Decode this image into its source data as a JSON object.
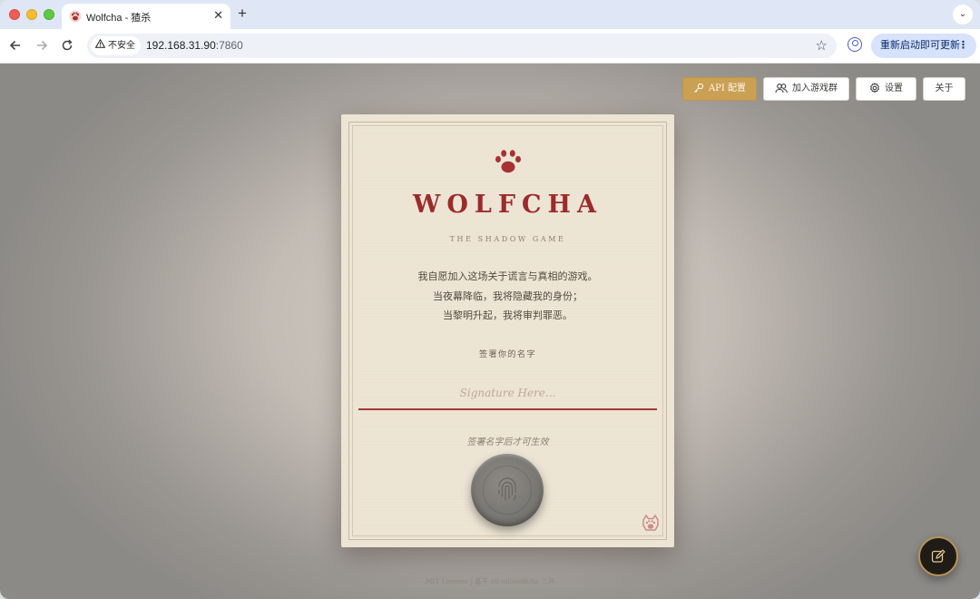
{
  "browser": {
    "tab_title": "Wolfcha - 猹杀",
    "tab_close": "✕",
    "new_tab": "+",
    "tab_menu": "⌄",
    "security_label": "不安全",
    "url_host": "192.168.31.90",
    "url_port": ":7860",
    "update_button": "重新启动即可更新"
  },
  "top_buttons": {
    "api": "API 配置",
    "join_group": "加入游戏群",
    "settings": "设置",
    "about": "关于"
  },
  "card": {
    "brand": "WOLFCHA",
    "tagline": "THE SHADOW GAME",
    "oath_lines": [
      "我自愿加入这场关于谎言与真相的游戏。",
      "当夜幕降临，我将隐藏我的身份；",
      "当黎明升起，我将审判罪恶。"
    ],
    "sign_label": "签署你的名字",
    "signature_value": "",
    "signature_placeholder": "Signature Here...",
    "sign_hint": "签署名字后才可生效"
  },
  "footer": "MIT License | 基于 oil-oil/wolfcha 二开",
  "colors": {
    "accent_red": "#9c2b2b",
    "accent_gold": "#c9a054",
    "paper": "#ece3d3"
  },
  "icons": {
    "api": "key-icon",
    "join_group": "users-icon",
    "settings": "gear-icon",
    "about": "none",
    "fab": "edit-icon",
    "seal": "fingerprint-icon"
  }
}
